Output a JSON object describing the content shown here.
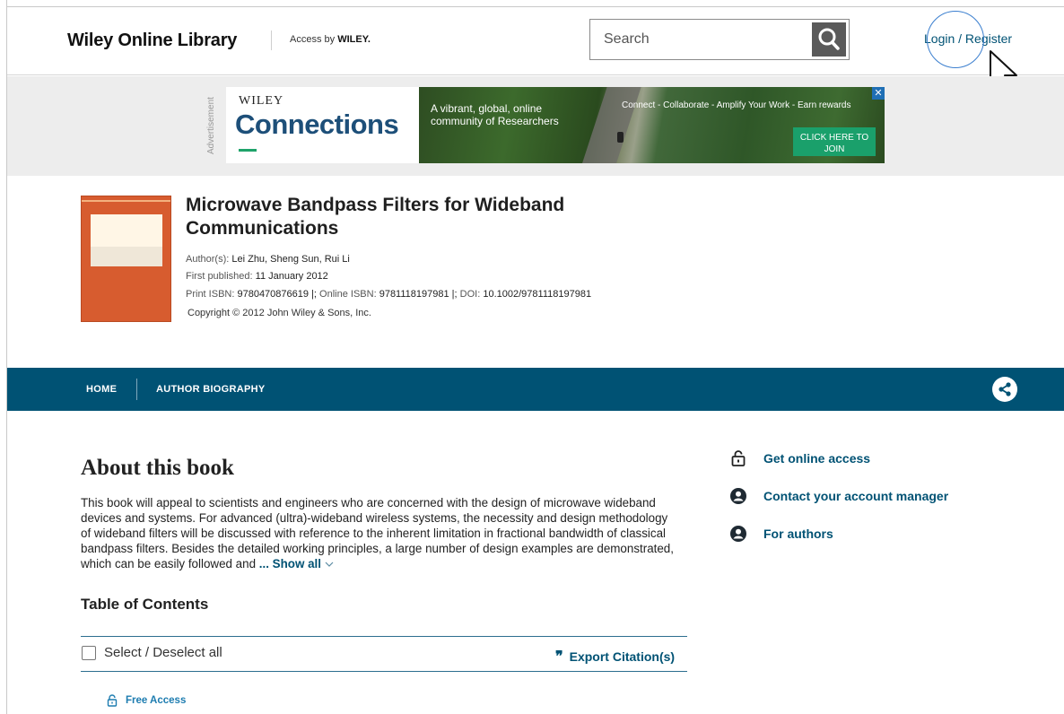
{
  "header": {
    "logo": "Wiley Online Library",
    "access_by_prefix": "Access by",
    "access_by_brand": "WILEY.",
    "search_placeholder": "Search",
    "login_label": "Login / Register"
  },
  "ad": {
    "label": "Advertisement",
    "brand_small": "WILEY",
    "brand_large": "Connections",
    "tagline_line1": "A vibrant, global, online",
    "tagline_line2": "community of Researchers",
    "slogan": "Connect - Collaborate - Amplify Your Work - Earn rewards",
    "cta_line1": "CLICK HERE TO",
    "cta_line2": "JOIN",
    "close_label": "✕"
  },
  "book": {
    "title": "Microwave Bandpass Filters for Wideband Communications",
    "authors_label": "Author(s):",
    "authors": "Lei Zhu,  Sheng Sun,  Rui Li",
    "first_published_label": "First published:",
    "first_published": "11 January 2012",
    "print_isbn_label": "Print ISBN:",
    "print_isbn": "9780470876619",
    "online_isbn_label": "Online ISBN:",
    "online_isbn": "9781118197981",
    "doi_label": "DOI:",
    "doi": "10.1002/9781118197981",
    "copyright": "Copyright © 2012 John Wiley & Sons, Inc."
  },
  "nav": {
    "home": "HOME",
    "author_biography": "AUTHOR BIOGRAPHY"
  },
  "about": {
    "title": "About this book",
    "text": "This book will appeal to scientists and engineers who are concerned with the design of microwave wideband devices and systems. For advanced (ultra)-wideband wireless systems, the necessity and design methodology of wideband filters will be discussed with reference to the inherent limitation in fractional bandwidth of classical bandpass filters. Besides the detailed working principles, a large number of design examples are demonstrated, which can be easily followed and",
    "ellipsis": "... ",
    "show_all": "Show all"
  },
  "toc": {
    "title": "Table of Contents",
    "select_all": "Select / Deselect all",
    "export_citation": "Export Citation(s)",
    "free_access": "Free Access"
  },
  "sidebar": {
    "links": [
      {
        "label": "Get online access"
      },
      {
        "label": "Contact your account manager"
      },
      {
        "label": "For authors"
      }
    ]
  },
  "colors": {
    "brand_blue": "#005274",
    "ad_green": "#1aa06b",
    "cover_orange": "#d75c2f"
  }
}
